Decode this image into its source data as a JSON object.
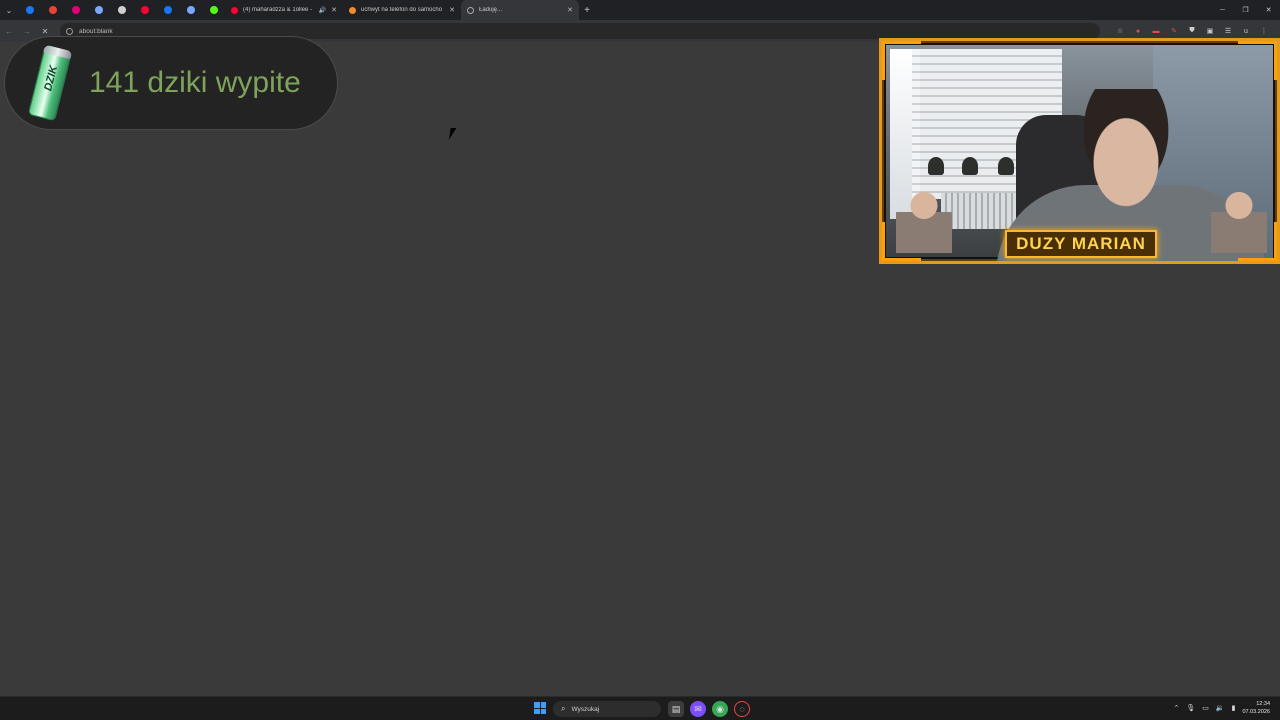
{
  "browser": {
    "pinned_tabs": [
      {
        "name": "pinned-tab-facebook",
        "color": "#1877f2"
      },
      {
        "name": "pinned-tab-gmail",
        "color": "#ea4335"
      },
      {
        "name": "pinned-tab-tmobile",
        "color": "#e20074"
      },
      {
        "name": "pinned-tab-generic",
        "color": "#7aa7ff"
      },
      {
        "name": "pinned-tab-chatgpt",
        "color": "#d0d0d0"
      },
      {
        "name": "pinned-tab-youtube",
        "color": "#ff0033"
      },
      {
        "name": "pinned-tab-facebook-2",
        "color": "#1877f2"
      },
      {
        "name": "pinned-tab-generic-2",
        "color": "#7aa7ff"
      },
      {
        "name": "pinned-tab-kick",
        "color": "#53fc18"
      }
    ],
    "tabs": [
      {
        "title": "(4) maharadzza & 1ollee -",
        "fav_color": "#ff0033",
        "audio": "🔊"
      },
      {
        "title": "uchwyt na telefon do samocho",
        "fav_color": "#f28c28"
      },
      {
        "title": "Ładuję...",
        "active": true
      }
    ],
    "new_tab": "+",
    "address": "about:blank"
  },
  "overlay": {
    "counter_text": "141 dziki wypite",
    "can_label": "DZIK",
    "nameplate": "DUZY MARIAN"
  },
  "taskbar": {
    "search_placeholder": "Wyszukaj",
    "time": "12:34",
    "date": "07.03.2026"
  }
}
